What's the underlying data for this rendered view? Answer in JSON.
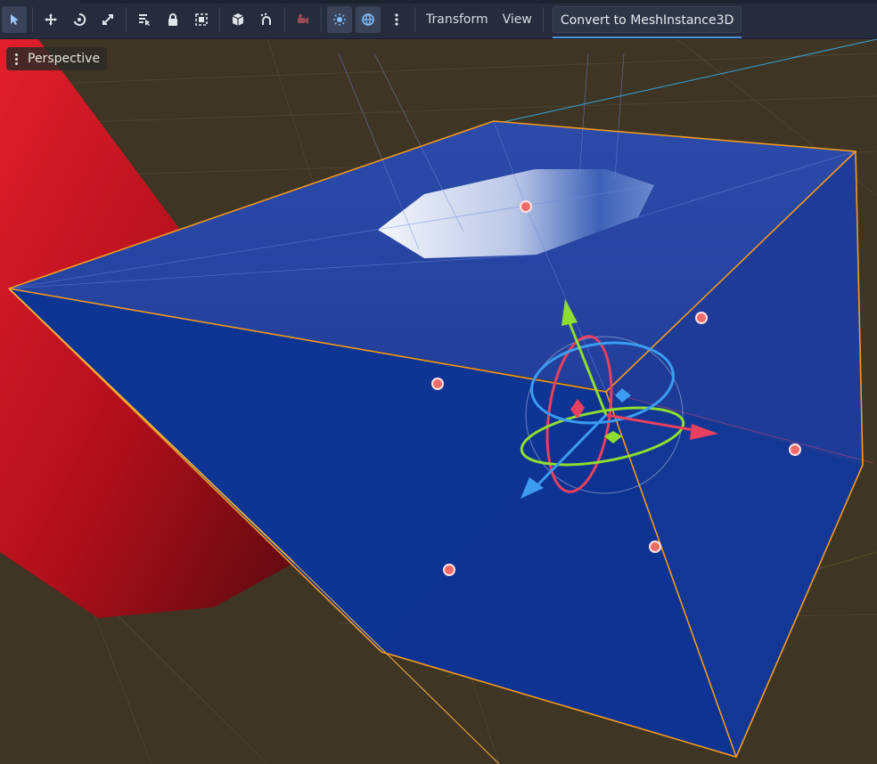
{
  "toolbar": {
    "tools": [
      {
        "name": "select-tool",
        "icon": "cursor-arrow-icon",
        "active": true
      },
      {
        "name": "move-tool",
        "icon": "move-arrows-icon",
        "active": false
      },
      {
        "name": "rotate-tool",
        "icon": "rotate-icon",
        "active": false
      },
      {
        "name": "scale-tool",
        "icon": "scale-icon",
        "active": false
      },
      {
        "name": "list-select-tool",
        "icon": "list-select-icon",
        "active": false
      },
      {
        "name": "lock-tool",
        "icon": "lock-icon",
        "active": false
      },
      {
        "name": "group-tool",
        "icon": "group-icon",
        "active": false
      },
      {
        "name": "local-space-tool",
        "icon": "cube-icon",
        "active": false
      },
      {
        "name": "snap-tool",
        "icon": "snap-magnet-icon",
        "active": false
      },
      {
        "name": "camera-override-tool",
        "icon": "camera-icon",
        "active": false
      },
      {
        "name": "preview-sun-toggle",
        "icon": "sun-icon",
        "active": true
      },
      {
        "name": "preview-environment-toggle",
        "icon": "globe-icon",
        "active": true
      },
      {
        "name": "more-options",
        "icon": "vertical-dots-icon",
        "active": false
      }
    ],
    "transform_label": "Transform",
    "view_label": "View",
    "convert_label": "Convert to MeshInstance3D"
  },
  "viewport": {
    "perspective_label": "Perspective",
    "colors": {
      "background": "#3f3525",
      "mesh_blue": "#123a98",
      "selection_orange": "#f39a1f",
      "red_object": "#c0101e",
      "gizmo_x": "#e8405e",
      "gizmo_y": "#8fdd2f",
      "gizmo_z": "#3b9cf0"
    }
  }
}
